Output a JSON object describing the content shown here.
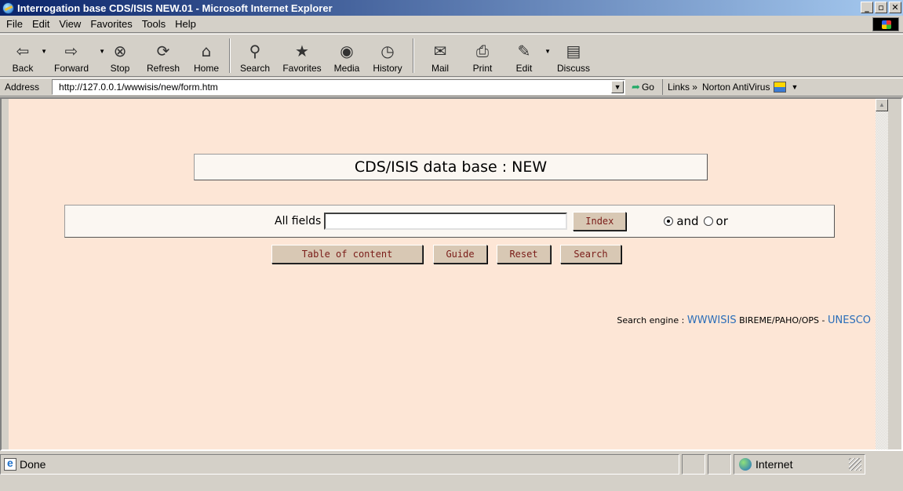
{
  "window": {
    "title": "Interrogation base CDS/ISIS NEW.01 - Microsoft Internet Explorer",
    "controls": [
      "_",
      "▫",
      "✕"
    ]
  },
  "menu": {
    "items": [
      "File",
      "Edit",
      "View",
      "Favorites",
      "Tools",
      "Help"
    ],
    "accelerators": [
      "F",
      "E",
      "V",
      "a",
      "T",
      "H"
    ]
  },
  "toolbar": {
    "buttons": [
      {
        "label": "Back",
        "icon": "back-arrow-icon",
        "glyph": "⇦"
      },
      {
        "label": "Forward",
        "icon": "forward-arrow-icon",
        "glyph": "⇨"
      },
      {
        "label": "Stop",
        "icon": "stop-icon",
        "glyph": "⊗"
      },
      {
        "label": "Refresh",
        "icon": "refresh-icon",
        "glyph": "⟳"
      },
      {
        "label": "Home",
        "icon": "home-icon",
        "glyph": "⌂"
      },
      {
        "label": "Search",
        "icon": "search-icon",
        "glyph": "⚲"
      },
      {
        "label": "Favorites",
        "icon": "favorites-icon",
        "glyph": "★"
      },
      {
        "label": "Media",
        "icon": "media-icon",
        "glyph": "◉"
      },
      {
        "label": "History",
        "icon": "history-icon",
        "glyph": "◷"
      },
      {
        "label": "Mail",
        "icon": "mail-icon",
        "glyph": "✉"
      },
      {
        "label": "Print",
        "icon": "print-icon",
        "glyph": "⎙"
      },
      {
        "label": "Edit",
        "icon": "edit-icon",
        "glyph": "✎"
      },
      {
        "label": "Discuss",
        "icon": "discuss-icon",
        "glyph": "▤"
      }
    ]
  },
  "address": {
    "label": "Address",
    "url": "http://127.0.0.1/wwwisis/new/form.htm",
    "go": "Go",
    "links": "Links »",
    "norton": "Norton AntiVirus"
  },
  "page": {
    "heading": "CDS/ISIS data base : NEW",
    "field_label": "All fields",
    "field_value": "",
    "index_button": "Index",
    "operator_and": "and",
    "operator_or": "or",
    "selected_operator": "and",
    "buttons": {
      "toc": "Table of content",
      "guide": "Guide",
      "reset": "Reset",
      "search": "Search"
    },
    "credits": {
      "prefix": "Search engine :",
      "engine": "WWWISIS",
      "org": "BIREME/PAHO/OPS -",
      "unesco": "UNESCO"
    }
  },
  "status": {
    "text": "Done",
    "zone": "Internet"
  },
  "colors": {
    "page_background": "#fde6d6",
    "button_background": "#d8c8b4",
    "button_text": "#7a1c18",
    "link": "#2a6db8",
    "titlebar_start": "#0a246a",
    "titlebar_end": "#a6caf0"
  }
}
